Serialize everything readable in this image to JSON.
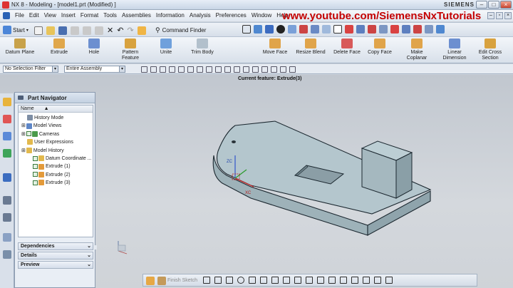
{
  "window": {
    "title": "NX 8 - Modeling - [model1.prt (Modified) ]",
    "brand": "SIEMENS"
  },
  "menu": {
    "items": [
      "File",
      "Edit",
      "View",
      "Insert",
      "Format",
      "Tools",
      "Assemblies",
      "Information",
      "Analysis",
      "Preferences",
      "Window",
      "Help"
    ]
  },
  "overlay": {
    "watermark": "www.youtube.com/SiemensNxTutorials"
  },
  "std_toolbar": {
    "start_label": "Start",
    "command_finder_label": "Command Finder"
  },
  "feature_toolbar": {
    "items": [
      {
        "label": "Datum Plane",
        "icon": "datum-plane-icon"
      },
      {
        "label": "Extrude",
        "icon": "extrude-icon"
      },
      {
        "label": "Hole",
        "icon": "hole-icon"
      },
      {
        "label": "Pattern\nFeature",
        "icon": "pattern-feature-icon"
      },
      {
        "label": "Unite",
        "icon": "unite-icon"
      },
      {
        "label": "Trim Body",
        "icon": "trim-body-icon"
      },
      {
        "label": "Move Face",
        "icon": "move-face-icon"
      },
      {
        "label": "Resize Blend",
        "icon": "resize-blend-icon"
      },
      {
        "label": "Delete Face",
        "icon": "delete-face-icon"
      },
      {
        "label": "Copy Face",
        "icon": "copy-face-icon"
      },
      {
        "label": "Make\nCoplanar",
        "icon": "make-coplanar-icon"
      },
      {
        "label": "Linear\nDimension",
        "icon": "linear-dimension-icon"
      },
      {
        "label": "Edit Cross\nSection",
        "icon": "edit-cross-section-icon"
      }
    ]
  },
  "selection_bar": {
    "filter": "No Selection Filter",
    "scope": "Entire Assembly"
  },
  "graphics": {
    "current_feature": "Current feature: Extrude(3)",
    "zc_label": "ZC",
    "xc_label": "XC",
    "yc_label": "YC"
  },
  "part_navigator": {
    "title": "Part Navigator",
    "column_name": "Name",
    "nodes": [
      {
        "label": "History Mode",
        "indent": 0,
        "checked": false
      },
      {
        "label": "Model Views",
        "indent": 0,
        "checked": false
      },
      {
        "label": "Cameras",
        "indent": 0,
        "checked": true
      },
      {
        "label": "User Expressions",
        "indent": 0,
        "checked": false
      },
      {
        "label": "Model History",
        "indent": 0,
        "checked": false
      },
      {
        "label": "Datum Coordinate ...",
        "indent": 1,
        "checked": true
      },
      {
        "label": "Extrude (1)",
        "indent": 1,
        "checked": true
      },
      {
        "label": "Extrude (2)",
        "indent": 1,
        "checked": true
      },
      {
        "label": "Extrude (3)",
        "indent": 1,
        "checked": true
      }
    ],
    "sections": [
      "Dependencies",
      "Details",
      "Preview"
    ]
  },
  "sketch_toolbar": {
    "finish_label": "Finish Sketch"
  }
}
